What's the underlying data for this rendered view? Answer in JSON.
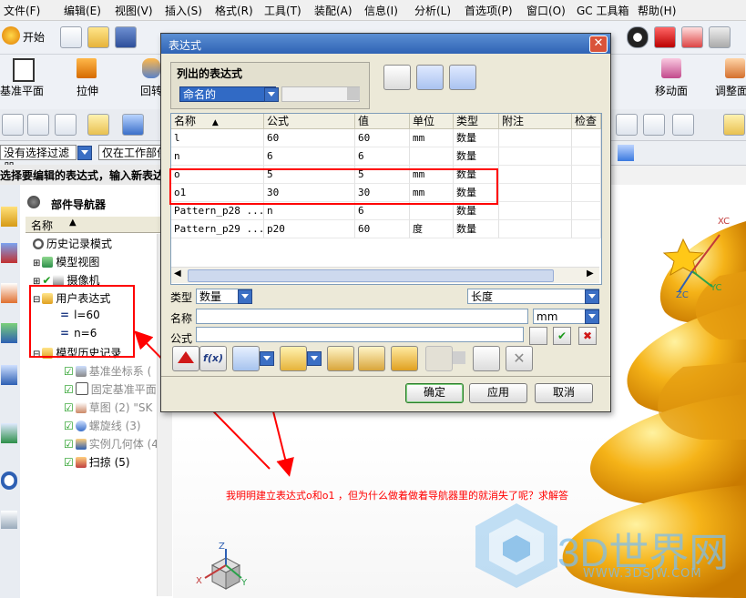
{
  "menu": [
    "文件(F)",
    "编辑(E)",
    "视图(V)",
    "插入(S)",
    "格式(R)",
    "工具(T)",
    "装配(A)",
    "信息(I)",
    "分析(L)",
    "首选项(P)",
    "窗口(O)",
    "GC 工具箱",
    "帮助(H)"
  ],
  "toolbar": {
    "start_label": "开始",
    "datum_plane_label": "基准平面",
    "extrude_label": "拉伸",
    "revolve_label": "回转",
    "move_face_label": "移动面",
    "resize_label": "调整面大小"
  },
  "filter": {
    "selection_filter": "没有选择过滤器",
    "scope": "仅在工作部件"
  },
  "status_text": "选择要编辑的表达式，输入新表达",
  "navigator": {
    "title": "部件导航器",
    "column_name": "名称",
    "items": [
      {
        "label": "历史记录模式",
        "dim": false
      },
      {
        "label": "模型视图",
        "dim": false
      },
      {
        "label": "摄像机",
        "dim": false
      },
      {
        "label": "用户表达式",
        "dim": false
      },
      {
        "label": "l=60",
        "dim": false
      },
      {
        "label": "n=6",
        "dim": false
      },
      {
        "label": "模型历史记录",
        "dim": false
      },
      {
        "label": "基准坐标系 (",
        "dim": true
      },
      {
        "label": "固定基准平面",
        "dim": true
      },
      {
        "label": "草图 (2) \"SK",
        "dim": true
      },
      {
        "label": "螺旋线 (3)",
        "dim": true
      },
      {
        "label": "实例几何体 (4)",
        "dim": true
      },
      {
        "label": "扫掠 (5)",
        "dim": false
      }
    ]
  },
  "dialog": {
    "title": "表达式",
    "list_label": "列出的表达式",
    "list_filter_value": "命名的",
    "columns": [
      "名称",
      "公式",
      "值",
      "单位",
      "类型",
      "附注",
      "检查"
    ],
    "rows": [
      [
        "l",
        "60",
        "60",
        "mm",
        "数量",
        "",
        ""
      ],
      [
        "n",
        "6",
        "6",
        "",
        "数量",
        "",
        ""
      ],
      [
        "o",
        "5",
        "5",
        "mm",
        "数量",
        "",
        ""
      ],
      [
        "o1",
        "30",
        "30",
        "mm",
        "数量",
        "",
        ""
      ],
      [
        "Pattern_p28 ...",
        "n",
        "6",
        "",
        "数量",
        "",
        ""
      ],
      [
        "Pattern_p29 ...",
        "p20",
        "60",
        "度",
        "数量",
        "",
        ""
      ]
    ],
    "type_label": "类型",
    "type_value": "数量",
    "dimension_value": "长度",
    "name_label": "名称",
    "unit_value": "mm",
    "formula_label": "公式",
    "ok_label": "确定",
    "apply_label": "应用",
    "cancel_label": "取消"
  },
  "annotation_text": "我明明建立表达式o和o1 ，但为什么做着做着导航器里的就消失了呢？求解答",
  "axes": {
    "xc": "XC",
    "yc": "YC",
    "zc": "ZC",
    "x": "X",
    "y": "Y",
    "z": "Z"
  },
  "watermark": {
    "title": "3D世界网",
    "url": "WWW.3DSJW.COM"
  },
  "colors": {
    "annotation": "#ff0000",
    "model": "#f5b318",
    "selection": "#316ac5",
    "title_bar": "#2f63b5"
  }
}
